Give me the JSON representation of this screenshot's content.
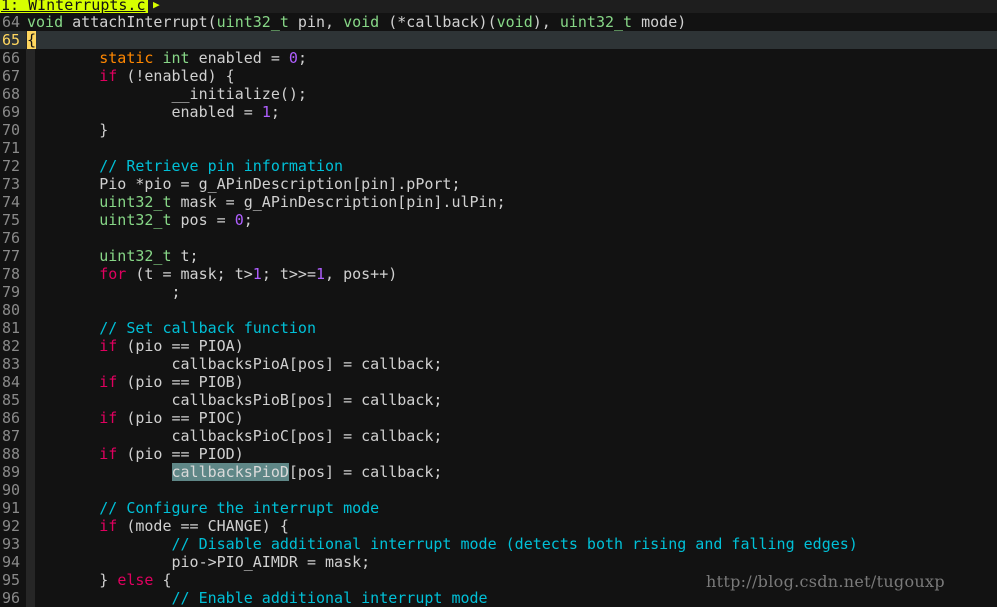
{
  "tab": {
    "label": "1: WInterrupts.c",
    "more": "▶"
  },
  "watermark": "http://blog.csdn.net/tugouxp",
  "cursor_line": 65,
  "lines": [
    {
      "n": "64",
      "tokens": [
        [
          "t",
          "void"
        ],
        [
          "p",
          " attachInterrupt("
        ],
        [
          "t",
          "uint32_t"
        ],
        [
          "p",
          " pin, "
        ],
        [
          "t",
          "void"
        ],
        [
          "p",
          " (*callback)("
        ],
        [
          "t",
          "void"
        ],
        [
          "p",
          "), "
        ],
        [
          "t",
          "uint32_t"
        ],
        [
          "p",
          " mode)"
        ]
      ]
    },
    {
      "n": "65",
      "tokens": [
        [
          "brace",
          "{"
        ]
      ]
    },
    {
      "n": "66",
      "tokens": [
        [
          "p",
          "        "
        ],
        [
          "s",
          "static"
        ],
        [
          "p",
          " "
        ],
        [
          "t",
          "int"
        ],
        [
          "p",
          " enabled = "
        ],
        [
          "n",
          "0"
        ],
        [
          "p",
          ";"
        ]
      ]
    },
    {
      "n": "67",
      "tokens": [
        [
          "p",
          "        "
        ],
        [
          "k",
          "if"
        ],
        [
          "p",
          " (!enabled) {"
        ]
      ]
    },
    {
      "n": "68",
      "tokens": [
        [
          "p",
          "                __initialize();"
        ]
      ]
    },
    {
      "n": "69",
      "tokens": [
        [
          "p",
          "                enabled = "
        ],
        [
          "n",
          "1"
        ],
        [
          "p",
          ";"
        ]
      ]
    },
    {
      "n": "70",
      "tokens": [
        [
          "p",
          "        }"
        ]
      ]
    },
    {
      "n": "71",
      "tokens": []
    },
    {
      "n": "72",
      "tokens": [
        [
          "p",
          "        "
        ],
        [
          "c",
          "// Retrieve pin information"
        ]
      ]
    },
    {
      "n": "73",
      "tokens": [
        [
          "p",
          "        Pio *pio = g_APinDescription[pin].pPort;"
        ]
      ]
    },
    {
      "n": "74",
      "tokens": [
        [
          "p",
          "        "
        ],
        [
          "t",
          "uint32_t"
        ],
        [
          "p",
          " mask = g_APinDescription[pin].ulPin;"
        ]
      ]
    },
    {
      "n": "75",
      "tokens": [
        [
          "p",
          "        "
        ],
        [
          "t",
          "uint32_t"
        ],
        [
          "p",
          " pos = "
        ],
        [
          "n",
          "0"
        ],
        [
          "p",
          ";"
        ]
      ]
    },
    {
      "n": "76",
      "tokens": []
    },
    {
      "n": "77",
      "tokens": [
        [
          "p",
          "        "
        ],
        [
          "t",
          "uint32_t"
        ],
        [
          "p",
          " t;"
        ]
      ]
    },
    {
      "n": "78",
      "tokens": [
        [
          "p",
          "        "
        ],
        [
          "k",
          "for"
        ],
        [
          "p",
          " (t = mask; t>"
        ],
        [
          "n",
          "1"
        ],
        [
          "p",
          "; t>>="
        ],
        [
          "n",
          "1"
        ],
        [
          "p",
          ", pos++)"
        ]
      ]
    },
    {
      "n": "79",
      "tokens": [
        [
          "p",
          "                ;"
        ]
      ]
    },
    {
      "n": "80",
      "tokens": []
    },
    {
      "n": "81",
      "tokens": [
        [
          "p",
          "        "
        ],
        [
          "c",
          "// Set callback function"
        ]
      ]
    },
    {
      "n": "82",
      "tokens": [
        [
          "p",
          "        "
        ],
        [
          "k",
          "if"
        ],
        [
          "p",
          " (pio == PIOA)"
        ]
      ]
    },
    {
      "n": "83",
      "tokens": [
        [
          "p",
          "                callbacksPioA[pos] = callback;"
        ]
      ]
    },
    {
      "n": "84",
      "tokens": [
        [
          "p",
          "        "
        ],
        [
          "k",
          "if"
        ],
        [
          "p",
          " (pio == PIOB)"
        ]
      ]
    },
    {
      "n": "85",
      "tokens": [
        [
          "p",
          "                callbacksPioB[pos] = callback;"
        ]
      ]
    },
    {
      "n": "86",
      "tokens": [
        [
          "p",
          "        "
        ],
        [
          "k",
          "if"
        ],
        [
          "p",
          " (pio == PIOC)"
        ]
      ]
    },
    {
      "n": "87",
      "tokens": [
        [
          "p",
          "                callbacksPioC[pos] = callback;"
        ]
      ]
    },
    {
      "n": "88",
      "tokens": [
        [
          "p",
          "        "
        ],
        [
          "k",
          "if"
        ],
        [
          "p",
          " (pio == PIOD)"
        ]
      ]
    },
    {
      "n": "89",
      "tokens": [
        [
          "p",
          "                "
        ],
        [
          "hl",
          "callbacksPioD"
        ],
        [
          "p",
          "[pos] = callback;"
        ]
      ]
    },
    {
      "n": "90",
      "tokens": []
    },
    {
      "n": "91",
      "tokens": [
        [
          "p",
          "        "
        ],
        [
          "c",
          "// Configure the interrupt mode"
        ]
      ]
    },
    {
      "n": "92",
      "tokens": [
        [
          "p",
          "        "
        ],
        [
          "k",
          "if"
        ],
        [
          "p",
          " (mode == CHANGE) {"
        ]
      ]
    },
    {
      "n": "93",
      "tokens": [
        [
          "p",
          "                "
        ],
        [
          "c",
          "// Disable additional interrupt mode (detects both rising and falling edges)"
        ]
      ]
    },
    {
      "n": "94",
      "tokens": [
        [
          "p",
          "                pio->PIO_AIMDR = mask;"
        ]
      ]
    },
    {
      "n": "95",
      "tokens": [
        [
          "p",
          "        } "
        ],
        [
          "k",
          "else"
        ],
        [
          "p",
          " {"
        ]
      ]
    },
    {
      "n": "96",
      "tokens": [
        [
          "p",
          "                "
        ],
        [
          "c",
          "// Enable additional interrupt mode"
        ]
      ]
    }
  ]
}
